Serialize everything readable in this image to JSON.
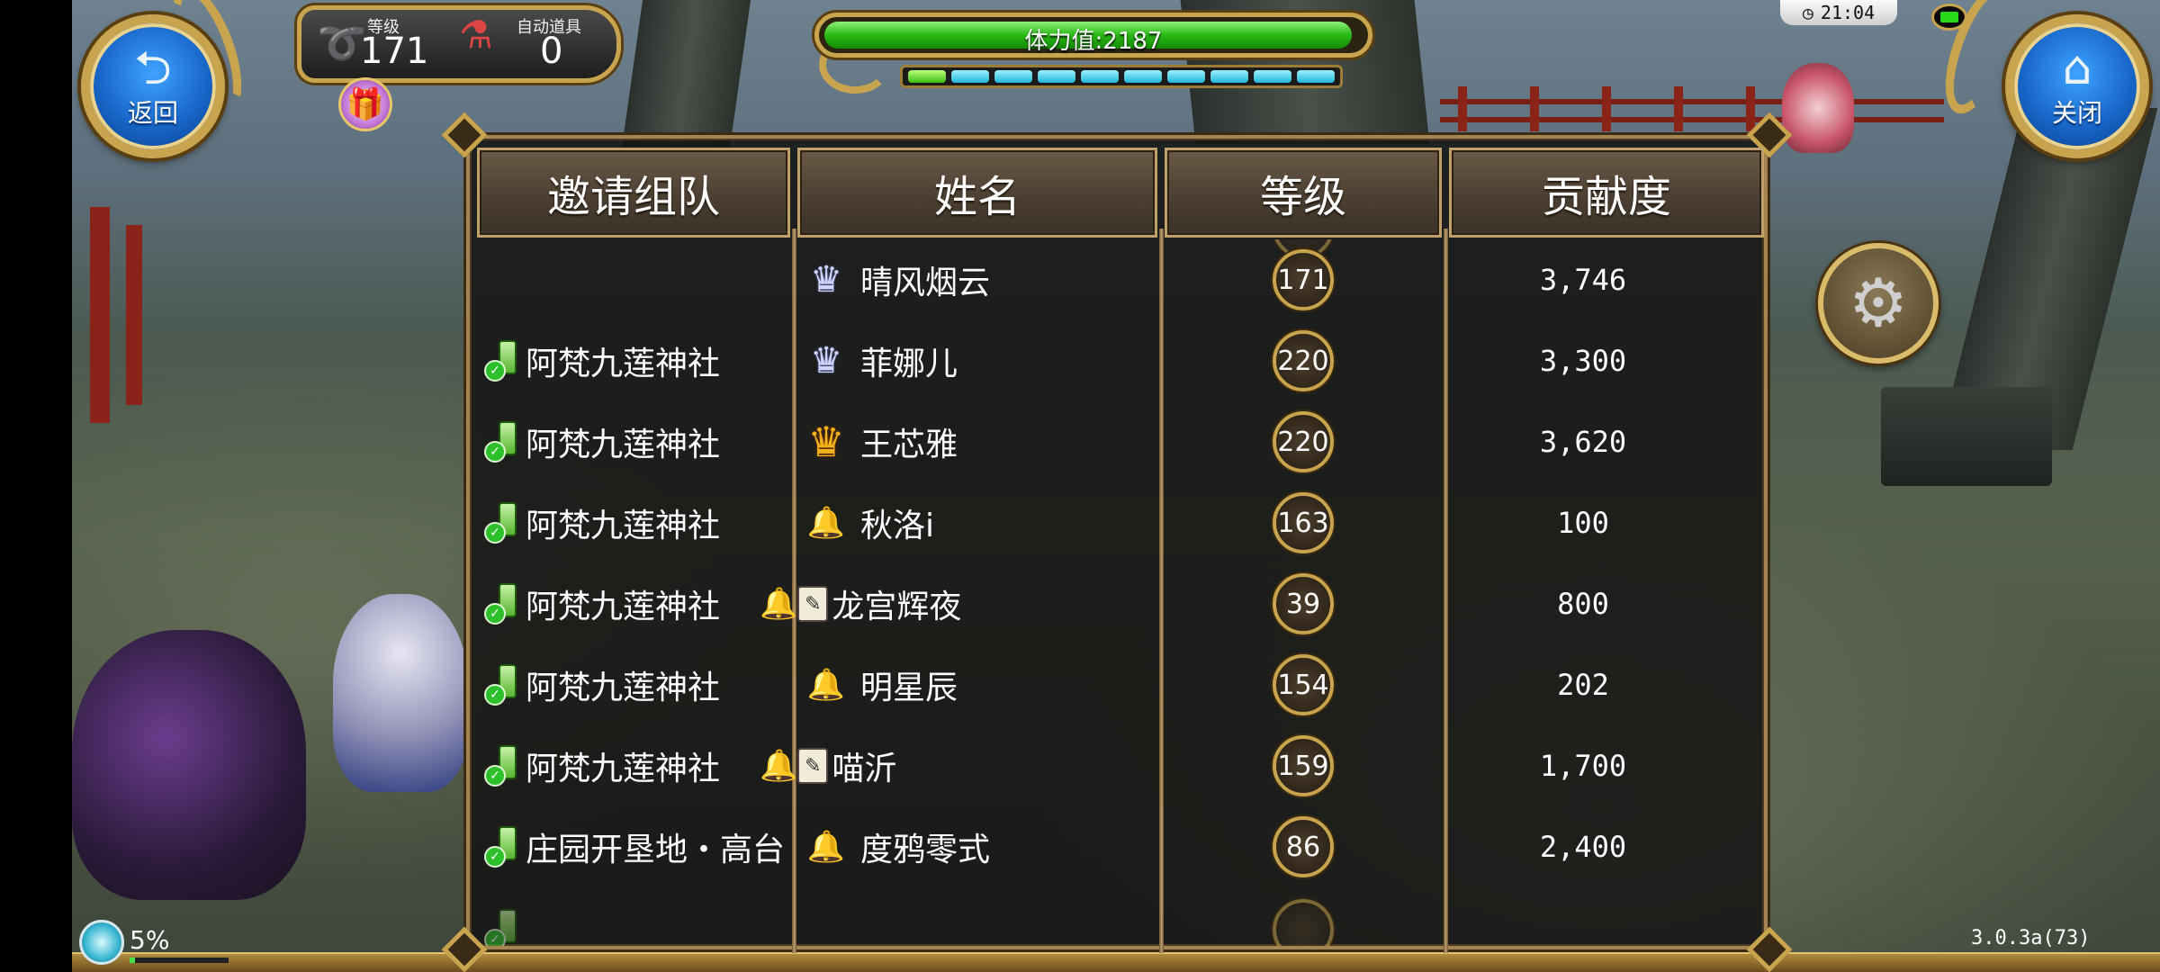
{
  "hud": {
    "level_label": "等级",
    "level_value": "171",
    "auto_item_label": "自动道具",
    "auto_item_value": "0",
    "stamina_text": "体力值:2187",
    "stamina_fraction": 0.98,
    "gauge_segments": {
      "total": 10,
      "green": 1
    },
    "clock": "21:04"
  },
  "buttons": {
    "back_label": "返回",
    "close_label": "关闭"
  },
  "panel": {
    "headers": {
      "team": "邀请组队",
      "name": "姓名",
      "level": "等级",
      "contribution": "贡献度"
    },
    "rows": [
      {
        "team": "",
        "name": "晴风烟云",
        "rank": "silver-crown",
        "level": "171",
        "contribution": "3,746",
        "phone": false
      },
      {
        "team": "阿梵九莲神社",
        "name": "菲娜儿",
        "rank": "silver-crown",
        "level": "220",
        "contribution": "3,300",
        "phone": true
      },
      {
        "team": "阿梵九莲神社",
        "name": "王芯雅",
        "rank": "gold-crown",
        "level": "220",
        "contribution": "3,620",
        "phone": true
      },
      {
        "team": "阿梵九莲神社",
        "name": "秋洛i",
        "rank": "bell",
        "level": "163",
        "contribution": "100",
        "phone": true
      },
      {
        "team": "阿梵九莲神社",
        "name": "龙宫辉夜",
        "rank": "bell-memo",
        "level": "39",
        "contribution": "800",
        "phone": true
      },
      {
        "team": "阿梵九莲神社",
        "name": "明星辰",
        "rank": "bell",
        "level": "154",
        "contribution": "202",
        "phone": true
      },
      {
        "team": "阿梵九莲神社",
        "name": "喵沂",
        "rank": "bell-memo",
        "level": "159",
        "contribution": "1,700",
        "phone": true
      },
      {
        "team": "庄园开垦地・高台",
        "name": "度鸦零式",
        "rank": "bell",
        "level": "86",
        "contribution": "2,400",
        "phone": true
      }
    ]
  },
  "footer": {
    "progress_text": "5%",
    "progress_fraction": 0.05,
    "version": "3.0.3a(73)"
  },
  "icons": {
    "back": "back-arrow-icon",
    "close": "home-icon",
    "settings": "gears-icon",
    "gift": "gift-icon",
    "flask": "potion-flask-icon"
  },
  "colors": {
    "gold": "#c9a44e",
    "button_blue": "#1866c8",
    "stamina_green": "#29b915",
    "gauge_cyan": "#1fb6d6"
  }
}
